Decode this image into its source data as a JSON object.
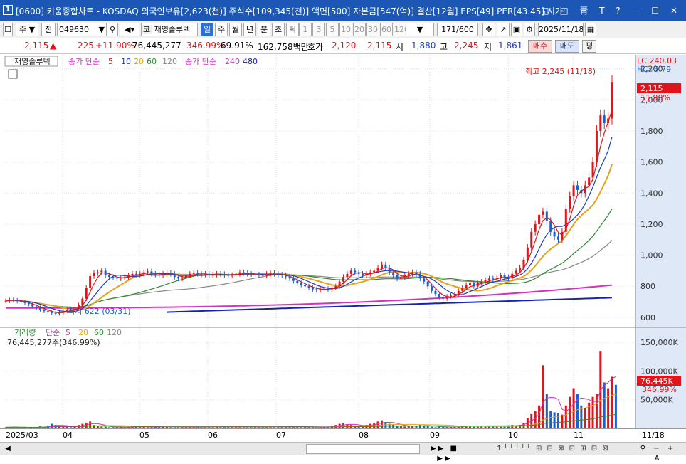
{
  "window": {
    "num": "1",
    "title": "[0600] 키움종합차트 - KOSDAQ 외국인보유[2,623(천)] 주식수[109,345(천)] 액면[500] 자본금[547(억)] 결산[12월] EPS[49] PER[43.45] 시가",
    "controls": "◱ ◰ 靑 T ? — ☐ ✕"
  },
  "toolbar": {
    "market": "주",
    "prev": "전",
    "code": "049630",
    "name_prefix": "코",
    "name": "재영솔루텍",
    "periods": [
      "일",
      "주",
      "월",
      "년",
      "분",
      "초",
      "틱"
    ],
    "active_period": "일",
    "ticks": [
      "1",
      "3",
      "5",
      "10",
      "20",
      "30",
      "60",
      "120"
    ],
    "count": "171",
    "count_total": "/600",
    "date": "2025/11/18"
  },
  "quote": {
    "price": "2,115",
    "arrow": "▲",
    "change": "225",
    "change_pct": "+11.90%",
    "volume": "76,445,277",
    "vol_ratio": "346.99%",
    "turnover": "69.91%",
    "amount": "162,758백만",
    "bid_label": "호가",
    "ask": "2,120",
    "bid": "2,115",
    "open_label": "시",
    "open": "1,880",
    "high_label": "고",
    "high": "2,245",
    "low_label": "저",
    "low": "1,861",
    "buy": "매수",
    "sell": "매도",
    "eval": "평"
  },
  "price_panel": {
    "name": "재영솔루텍",
    "ma_label": "종가 단순",
    "ma_periods": [
      "5",
      "10",
      "20",
      "60",
      "120"
    ],
    "ma2_label": "종가 단순",
    "ma2_periods": [
      "240",
      "480"
    ],
    "lc": "LC:240.03",
    "hc": "HC:-5.79",
    "hi_label": "최고 2,245 (11/18)",
    "lo_label": "최저 622 (03/31)",
    "cur_price": "2,115",
    "cur_pct": "11.90%",
    "y_ticks": [
      "2,200",
      "2,000",
      "1,800",
      "1,600",
      "1,400",
      "1,200",
      "1,000",
      "800",
      "600"
    ]
  },
  "volume_panel": {
    "title": "거래량",
    "ma_label": "단순",
    "ma_periods": [
      "5",
      "20",
      "60",
      "120"
    ],
    "value_text": "76,445,277주(346.99%)",
    "y_ticks": [
      "150,000K",
      "100,000K",
      "50,000K"
    ],
    "cur_vol": "76,445K",
    "cur_pct": "346.99%"
  },
  "x_axis": {
    "labels": [
      "2025/03",
      "04",
      "05",
      "06",
      "07",
      "08",
      "09",
      "10",
      "11"
    ],
    "right_label": "11/18"
  },
  "colors": {
    "up": "#e0151b",
    "down": "#1a5fd0",
    "ma5": "#e0151b",
    "ma10": "#1a3cc8",
    "ma20": "#e8a21a",
    "ma60": "#2e8b2e",
    "ma120": "#888888",
    "ma240": "#d62fc2",
    "ma480": "#1422b8"
  },
  "chart_data": {
    "type": "candlestick",
    "y_axis": {
      "min": 540,
      "max": 2290
    },
    "volume_axis": {
      "max": 160000
    },
    "closes": [
      706,
      712,
      710,
      704,
      698,
      692,
      685,
      670,
      662,
      650,
      640,
      636,
      628,
      624,
      630,
      640,
      650,
      648,
      655,
      680,
      720,
      790,
      865,
      885,
      890,
      900,
      870,
      860,
      855,
      850,
      855,
      860,
      870,
      880,
      875,
      880,
      890,
      895,
      880,
      875,
      870,
      880,
      885,
      880,
      860,
      850,
      855,
      870,
      880,
      885,
      880,
      875,
      880,
      870,
      875,
      880,
      878,
      872,
      868,
      872,
      880,
      890,
      885,
      880,
      878,
      875,
      872,
      868,
      880,
      885,
      880,
      875,
      870,
      862,
      850,
      835,
      820,
      810,
      800,
      790,
      780,
      775,
      782,
      785,
      780,
      790,
      800,
      830,
      860,
      880,
      900,
      890,
      880,
      870,
      880,
      890,
      900,
      920,
      940,
      920,
      890,
      870,
      850,
      860,
      870,
      880,
      890,
      880,
      850,
      830,
      800,
      770,
      750,
      730,
      720,
      735,
      740,
      745,
      770,
      790,
      810,
      820,
      800,
      820,
      830,
      840,
      850,
      845,
      855,
      870,
      860,
      850,
      880,
      900,
      920,
      970,
      1050,
      1150,
      1200,
      1260,
      1280,
      1220,
      1150,
      1120,
      1100,
      1150,
      1300,
      1380,
      1450,
      1420,
      1400,
      1450,
      1500,
      1600,
      1800,
      1900,
      1850,
      1880,
      2115
    ],
    "volumes": [
      2,
      2,
      3,
      2,
      1,
      2,
      1,
      2,
      2,
      4,
      3,
      5,
      8,
      6,
      4,
      3,
      3,
      2,
      4,
      6,
      8,
      10,
      12,
      6,
      4,
      3,
      3,
      2,
      2,
      2,
      3,
      2,
      2,
      3,
      4,
      2,
      3,
      2,
      2,
      3,
      3,
      4,
      3,
      2,
      2,
      3,
      2,
      2,
      2,
      3,
      2,
      2,
      3,
      2,
      3,
      4,
      2,
      2,
      3,
      2,
      3,
      3,
      2,
      3,
      2,
      2,
      2,
      2,
      3,
      4,
      2,
      2,
      3,
      2,
      4,
      3,
      3,
      2,
      3,
      2,
      2,
      2,
      3,
      2,
      3,
      4,
      6,
      8,
      9,
      7,
      6,
      5,
      4,
      4,
      6,
      8,
      9,
      12,
      14,
      10,
      8,
      7,
      5,
      4,
      3,
      4,
      5,
      4,
      6,
      5,
      4,
      3,
      2,
      3,
      3,
      2,
      2,
      3,
      3,
      4,
      4,
      5,
      3,
      3,
      4,
      3,
      5,
      4,
      3,
      3,
      4,
      5,
      6,
      5,
      6,
      10,
      18,
      25,
      30,
      40,
      110,
      60,
      30,
      28,
      26,
      24,
      40,
      55,
      70,
      60,
      40,
      35,
      45,
      55,
      60,
      135,
      80,
      70,
      90,
      76
    ]
  }
}
